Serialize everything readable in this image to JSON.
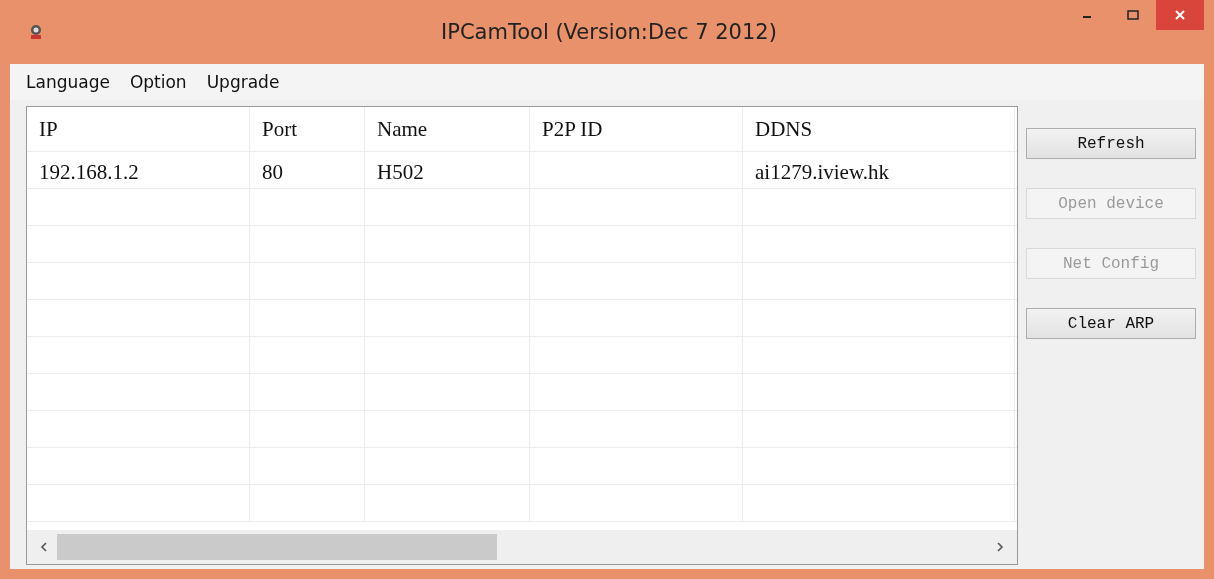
{
  "window": {
    "title": "IPCamTool (Version:Dec  7 2012)"
  },
  "menu": [
    "Language",
    "Option",
    "Upgrade"
  ],
  "table": {
    "columns": [
      "IP",
      "Port",
      "Name",
      "P2P ID",
      "DDNS"
    ],
    "rows": [
      [
        "192.168.1.2",
        "80",
        "H502",
        "",
        "ai1279.iview.hk"
      ]
    ]
  },
  "buttons": [
    {
      "label": "Refresh",
      "disabled": false
    },
    {
      "label": "Open device",
      "disabled": true
    },
    {
      "label": "Net Config",
      "disabled": true
    },
    {
      "label": "Clear ARP",
      "disabled": false
    }
  ]
}
